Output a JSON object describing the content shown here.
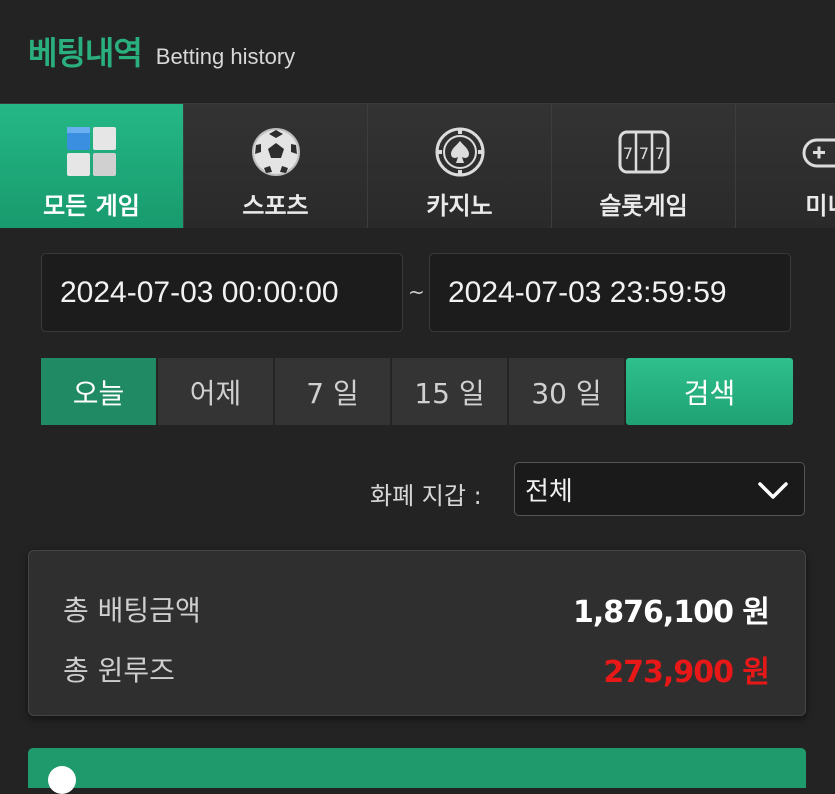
{
  "header": {
    "title_ko": "베팅내역",
    "title_en": "Betting history"
  },
  "tabs": [
    {
      "label": "모든 게임",
      "icon": "all-games-icon",
      "active": true
    },
    {
      "label": "스포츠",
      "icon": "soccer-ball-icon",
      "active": false
    },
    {
      "label": "카지노",
      "icon": "casino-chip-icon",
      "active": false
    },
    {
      "label": "슬롯게임",
      "icon": "slot-machine-icon",
      "active": false
    },
    {
      "label": "미니",
      "icon": "gamepad-icon",
      "active": false
    }
  ],
  "date_range": {
    "start": "2024-07-03 00:00:00",
    "separator": "~",
    "end": "2024-07-03 23:59:59"
  },
  "quick_filters": {
    "today": "오늘",
    "yesterday": "어제",
    "d7": "7 일",
    "d15": "15 일",
    "d30": "30 일",
    "search": "검색"
  },
  "currency_wallet": {
    "label": "화폐 지갑 :",
    "selected": "전체"
  },
  "summary": {
    "total_bet_label": "총 배팅금액",
    "total_bet_value": "1,876,100 원",
    "total_winloss_label": "총 윈루즈",
    "total_winloss_value": "273,900 원"
  },
  "colors": {
    "accent": "#1fa274",
    "title_green": "#2ab07e",
    "negative_red": "#e81818",
    "background": "#232323"
  }
}
